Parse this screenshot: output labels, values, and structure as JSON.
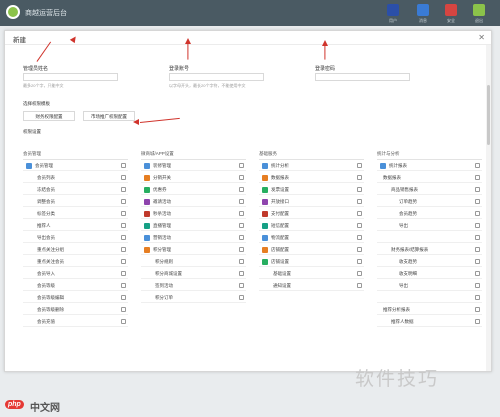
{
  "header": {
    "title": "商越运营后台",
    "icons": [
      {
        "name": "user-icon",
        "label": "用户",
        "color": "#2b4fa8"
      },
      {
        "name": "message-icon",
        "label": "消息",
        "color": "#3a7bd5"
      },
      {
        "name": "shield-icon",
        "label": "安全",
        "color": "#d64541"
      },
      {
        "name": "logout-icon",
        "label": "退出",
        "color": "#8bc34a"
      }
    ]
  },
  "dialog": {
    "title": "新建",
    "close": "✕",
    "fields": [
      {
        "label": "管理员姓名",
        "hint": "最多20个字，只能中文"
      },
      {
        "label": "登录账号",
        "hint": "以字母开头，最长20个字符，不能使用中文"
      },
      {
        "label": "登录密码",
        "hint": ""
      }
    ],
    "template_label": "选择权限模板",
    "template_buttons": [
      "财务权限配置",
      "市场推广权限配置"
    ],
    "perm_label": "权限设置",
    "columns": [
      {
        "title": "会员管理",
        "rows": [
          {
            "text": "会员管理",
            "icon": true,
            "level": 0
          },
          {
            "text": "会员列表",
            "level": 1
          },
          {
            "text": "冻结会员",
            "level": 1
          },
          {
            "text": "调整会员",
            "level": 1
          },
          {
            "text": "标签分类",
            "level": 1
          },
          {
            "text": "推荐人",
            "level": 1
          },
          {
            "text": "导出会员",
            "level": 1
          },
          {
            "text": "重点关注分组",
            "level": 1
          },
          {
            "text": "重点关注会员",
            "level": 1
          },
          {
            "text": "会员导入",
            "level": 1
          },
          {
            "text": "会员等级",
            "level": 1
          },
          {
            "text": "会员等级编辑",
            "level": 1
          },
          {
            "text": "会员等级删除",
            "level": 1
          },
          {
            "text": "会员充值",
            "level": 1
          }
        ]
      },
      {
        "title": "微商城/APP设置",
        "rows": [
          {
            "text": "装修管理",
            "icon": true,
            "level": 0
          },
          {
            "text": "分销开关",
            "icon": true,
            "level": 0
          },
          {
            "text": "优惠券",
            "icon": true,
            "level": 0
          },
          {
            "text": "邀请活动",
            "icon": true,
            "level": 0
          },
          {
            "text": "秒杀活动",
            "icon": true,
            "level": 0
          },
          {
            "text": "直播管理",
            "icon": true,
            "level": 0
          },
          {
            "text": "营销活动",
            "icon": true,
            "level": 0
          },
          {
            "text": "积分管理",
            "icon": true,
            "level": 0
          },
          {
            "text": "积分规则",
            "level": 1
          },
          {
            "text": "积分商城设置",
            "level": 1
          },
          {
            "text": "签到活动",
            "level": 1
          },
          {
            "text": "积分订单",
            "level": 1
          }
        ]
      },
      {
        "title": "基础服务",
        "rows": [
          {
            "text": "统计分析",
            "icon": true,
            "level": 0
          },
          {
            "text": "数据报表",
            "icon": true,
            "level": 0
          },
          {
            "text": "发票设置",
            "icon": true,
            "level": 0
          },
          {
            "text": "开放接口",
            "icon": true,
            "level": 0
          },
          {
            "text": "支付配置",
            "icon": true,
            "level": 0
          },
          {
            "text": "短信配置",
            "icon": true,
            "level": 0
          },
          {
            "text": "物流配置",
            "icon": true,
            "level": 0
          },
          {
            "text": "店铺配置",
            "icon": true,
            "level": 0
          },
          {
            "text": "店铺设置",
            "icon": true,
            "level": 0
          },
          {
            "text": "基础设置",
            "level": 1
          },
          {
            "text": "通知设置",
            "level": 1
          }
        ]
      },
      {
        "title": "统计与分析",
        "rows": [
          {
            "text": "统计报表",
            "icon": true,
            "level": 0
          },
          {
            "text": "数据报表",
            "level": 0
          },
          {
            "text": "商品销售报表",
            "level": 1
          },
          {
            "text": "订单趋势",
            "level": 2
          },
          {
            "text": "会员趋势",
            "level": 2
          },
          {
            "text": "导出",
            "level": 2
          },
          {
            "text": "",
            "level": 2
          },
          {
            "text": "财务报表/结算报表",
            "level": 1
          },
          {
            "text": "收支趋势",
            "level": 2
          },
          {
            "text": "收支明细",
            "level": 2
          },
          {
            "text": "导出",
            "level": 2
          },
          {
            "text": "",
            "level": 2
          },
          {
            "text": "推荐分析报表",
            "level": 0
          },
          {
            "text": "推荐人数据",
            "level": 1
          }
        ]
      }
    ]
  },
  "watermarks": {
    "tr": "软件技巧",
    "badge": "php",
    "text": "中文网"
  }
}
